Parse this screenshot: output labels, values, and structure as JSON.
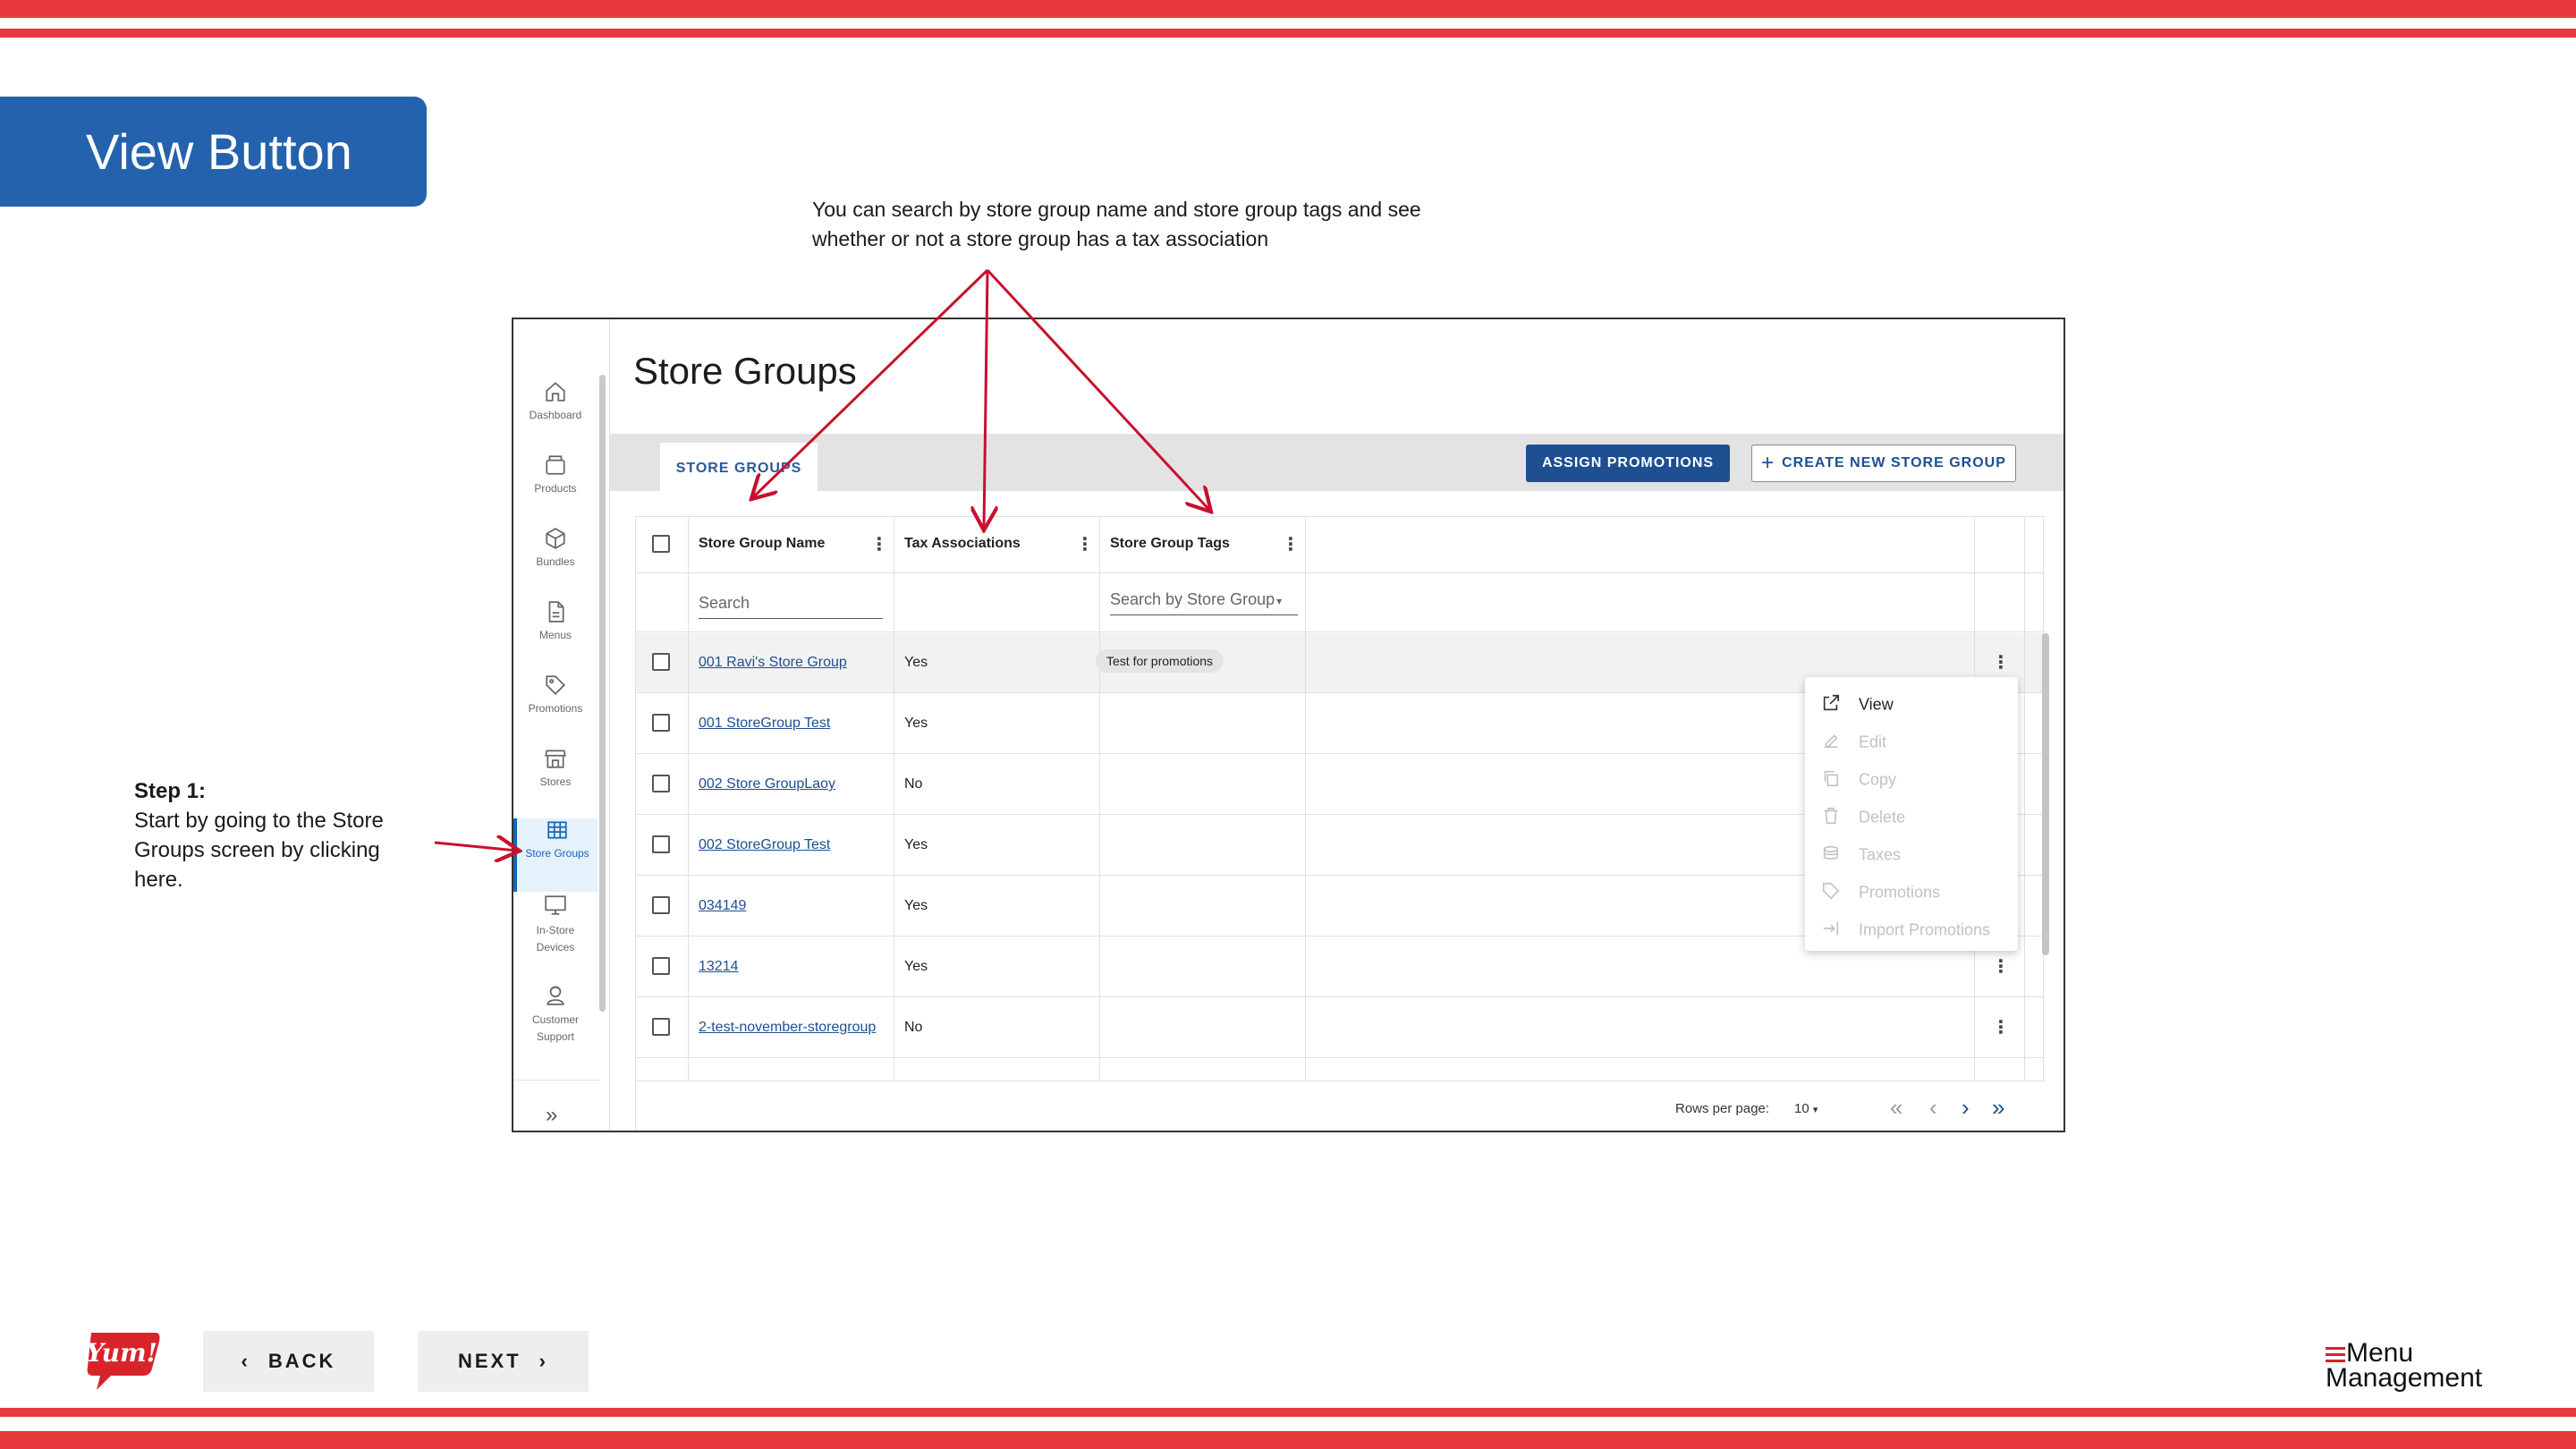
{
  "slide": {
    "title": "View Button",
    "annotation_top": "You can search by store group name and store group tags and see whether or not a store group has a tax association",
    "step_title": "Step 1:",
    "step_text": "Start by going to the Store Groups screen by clicking here.",
    "back_label": "BACK",
    "next_label": "NEXT",
    "brand_logo": "Yum!",
    "product_logo_line1": "Menu",
    "product_logo_line2": "Management",
    "colors": {
      "stripe": "#e8393f",
      "title_box": "#2462ad",
      "arrow": "#c8102e"
    }
  },
  "sidebar": {
    "items": [
      {
        "label": "Dashboard",
        "icon": "home-icon"
      },
      {
        "label": "Products",
        "icon": "box-icon"
      },
      {
        "label": "Bundles",
        "icon": "cube-icon"
      },
      {
        "label": "Menus",
        "icon": "document-icon"
      },
      {
        "label": "Promotions",
        "icon": "tag-icon"
      },
      {
        "label": "Stores",
        "icon": "storefront-icon"
      },
      {
        "label": "Store Groups",
        "icon": "grid-icon",
        "active": true
      },
      {
        "label": "In-Store Devices",
        "line1": "In-Store",
        "line2": "Devices",
        "icon": "monitor-icon"
      },
      {
        "label": "Customer Support",
        "line1": "Customer",
        "line2": "Support",
        "icon": "support-icon"
      }
    ],
    "collapse_icon": "double-chevron-right-icon"
  },
  "page": {
    "title": "Store Groups",
    "tab_label": "STORE GROUPS",
    "assign_label": "ASSIGN PROMOTIONS",
    "create_label": "CREATE NEW STORE GROUP"
  },
  "table": {
    "columns": [
      "Store Group Name",
      "Tax Associations",
      "Store Group Tags"
    ],
    "search_placeholder": "Search",
    "tag_search_placeholder": "Search by Store Group",
    "rows": [
      {
        "name": "001 Ravi's Store Group",
        "tax": "Yes",
        "tag": "Test for promotions"
      },
      {
        "name": "001 StoreGroup Test",
        "tax": "Yes",
        "tag": ""
      },
      {
        "name": "002 Store GroupLaoy",
        "tax": "No",
        "tag": ""
      },
      {
        "name": "002 StoreGroup Test",
        "tax": "Yes",
        "tag": ""
      },
      {
        "name": "034149",
        "tax": "Yes",
        "tag": ""
      },
      {
        "name": "13214",
        "tax": "Yes",
        "tag": ""
      },
      {
        "name": "2-test-november-storegroup",
        "tax": "No",
        "tag": ""
      }
    ],
    "rows_per_page_label": "Rows per page:",
    "rows_per_page_value": "10"
  },
  "context_menu": {
    "items": [
      {
        "label": "View",
        "enabled": true,
        "icon": "open-external-icon"
      },
      {
        "label": "Edit",
        "enabled": false,
        "icon": "edit-icon"
      },
      {
        "label": "Copy",
        "enabled": false,
        "icon": "copy-icon"
      },
      {
        "label": "Delete",
        "enabled": false,
        "icon": "trash-icon"
      },
      {
        "label": "Taxes",
        "enabled": false,
        "icon": "coins-icon"
      },
      {
        "label": "Promotions",
        "enabled": false,
        "icon": "tag-icon"
      },
      {
        "label": "Import Promotions",
        "enabled": false,
        "icon": "import-icon"
      }
    ]
  }
}
